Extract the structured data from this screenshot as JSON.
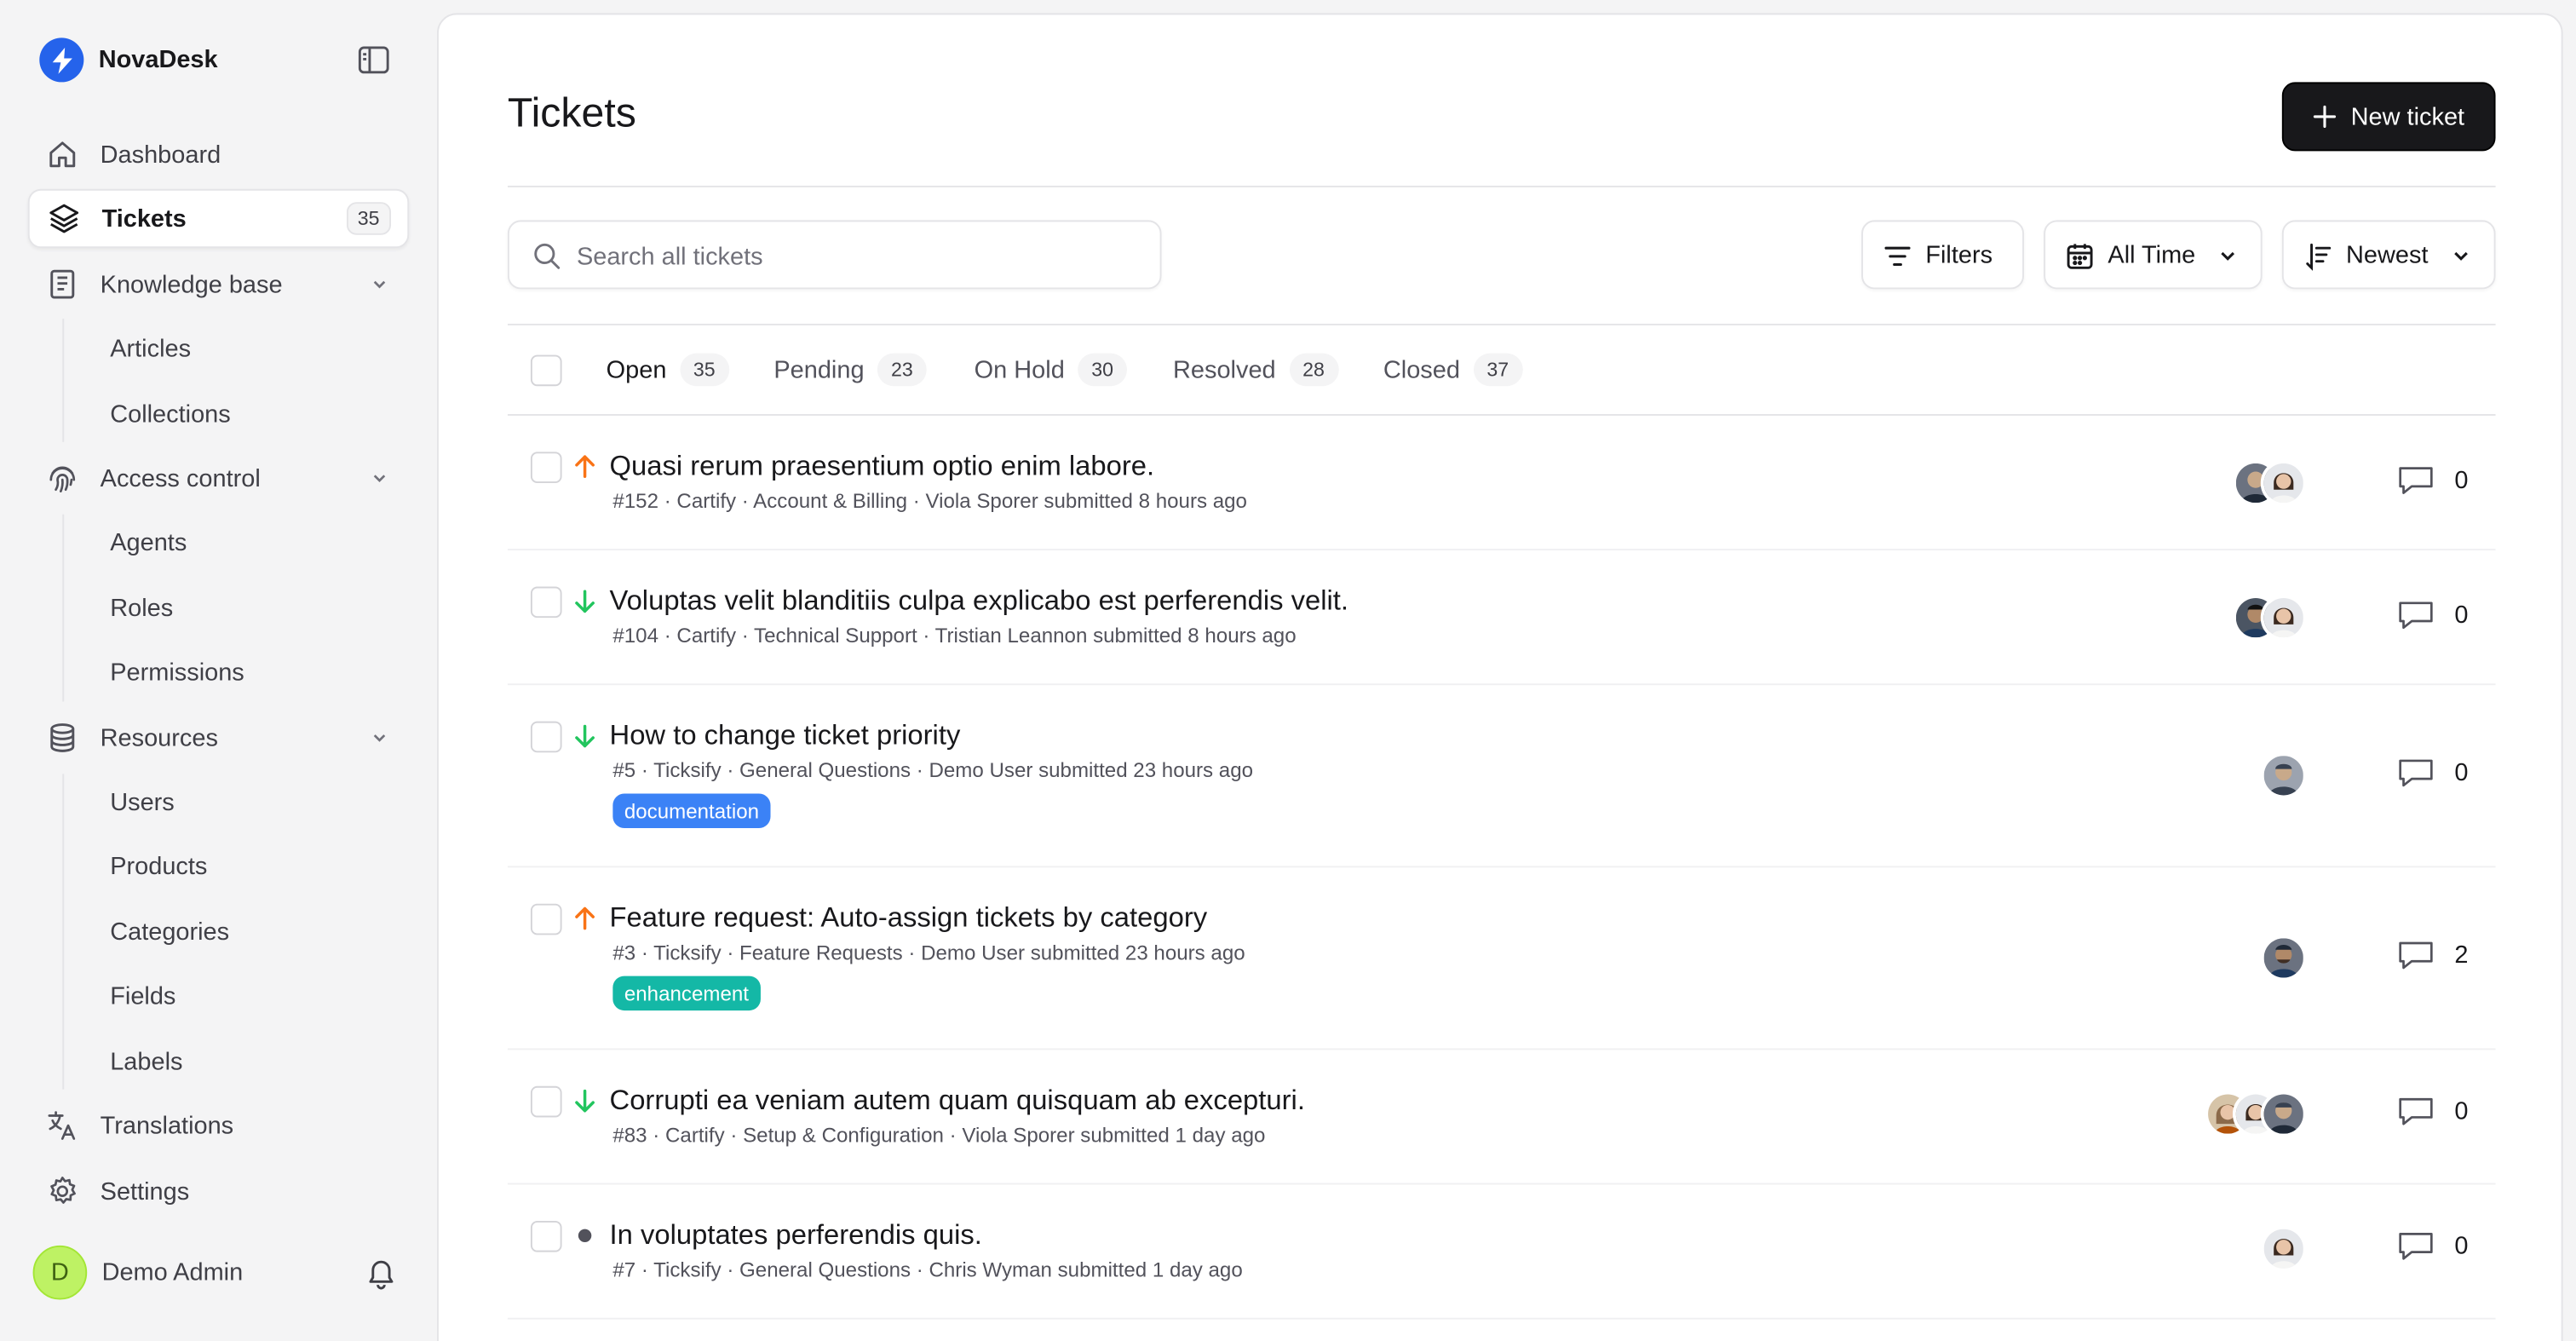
{
  "app": {
    "name": "NovaDesk",
    "brand_color": "#2563eb"
  },
  "sidebar": {
    "items": [
      {
        "label": "Dashboard",
        "icon": "home-icon"
      },
      {
        "label": "Tickets",
        "icon": "layers-icon",
        "badge": "35",
        "active": true
      },
      {
        "label": "Knowledge base",
        "icon": "book-icon",
        "children": [
          "Articles",
          "Collections"
        ]
      },
      {
        "label": "Access control",
        "icon": "fingerprint-icon",
        "children": [
          "Agents",
          "Roles",
          "Permissions"
        ]
      },
      {
        "label": "Resources",
        "icon": "database-icon",
        "children": [
          "Users",
          "Products",
          "Categories",
          "Fields",
          "Labels"
        ]
      },
      {
        "label": "Translations",
        "icon": "translate-icon"
      },
      {
        "label": "Settings",
        "icon": "gear-icon"
      }
    ],
    "user": {
      "initial": "D",
      "name": "Demo Admin"
    }
  },
  "main": {
    "title": "Tickets",
    "new_button": "New ticket",
    "search": {
      "placeholder": "Search all tickets",
      "value": ""
    },
    "toolbar": {
      "filters": "Filters",
      "time": "All Time",
      "sort": "Newest"
    },
    "tabs": [
      {
        "label": "Open",
        "count": "35",
        "active": true
      },
      {
        "label": "Pending",
        "count": "23"
      },
      {
        "label": "On Hold",
        "count": "30"
      },
      {
        "label": "Resolved",
        "count": "28"
      },
      {
        "label": "Closed",
        "count": "37"
      }
    ],
    "tickets": [
      {
        "title": "Quasi rerum praesentium optio enim labore.",
        "meta": "#152 · Cartify · Account & Billing · Viola Sporer submitted 8 hours ago",
        "priority": "high",
        "comments": "0",
        "avatars": 2
      },
      {
        "title": "Voluptas velit blanditiis culpa explicabo est perferendis velit.",
        "meta": "#104 · Cartify · Technical Support · Tristian Leannon submitted 8 hours ago",
        "priority": "low",
        "comments": "0",
        "avatars": 2
      },
      {
        "title": "How to change ticket priority",
        "meta": "#5 · Ticksify · General Questions · Demo User submitted 23 hours ago",
        "priority": "low",
        "comments": "0",
        "avatars": 1,
        "label": "documentation",
        "label_color": "#3b82f6"
      },
      {
        "title": "Feature request: Auto-assign tickets by category",
        "meta": "#3 · Ticksify · Feature Requests · Demo User submitted 23 hours ago",
        "priority": "high",
        "comments": "2",
        "avatars": 1,
        "label": "enhancement",
        "label_color": "#14b8a6"
      },
      {
        "title": "Corrupti ea veniam autem quam quisquam ab excepturi.",
        "meta": "#83 · Cartify · Setup & Configuration · Viola Sporer submitted 1 day ago",
        "priority": "low",
        "comments": "0",
        "avatars": 3
      },
      {
        "title": "In voluptates perferendis quis.",
        "meta": "#7 · Ticksify · General Questions · Chris Wyman submitted 1 day ago",
        "priority": "normal",
        "comments": "0",
        "avatars": 1
      }
    ]
  },
  "colors": {
    "priority_high": "#f97316",
    "priority_low": "#22c55e",
    "priority_normal": "#52525b"
  }
}
